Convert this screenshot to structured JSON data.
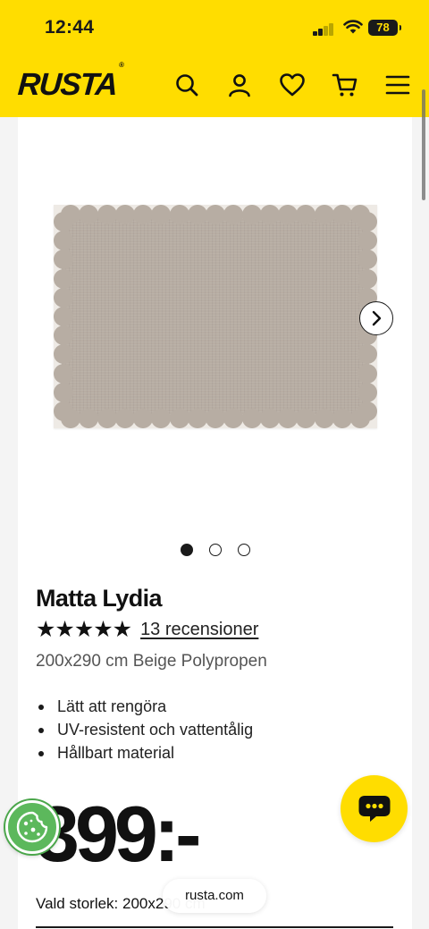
{
  "status_bar": {
    "time": "12:44",
    "battery": "78"
  },
  "header": {
    "logo": "RUSTA",
    "logo_mark": "®",
    "icons": [
      "search-icon",
      "account-icon",
      "heart-icon",
      "cart-icon",
      "menu-icon"
    ],
    "background": "#ffdd00"
  },
  "gallery": {
    "image": "rug-image",
    "slide_count": 3,
    "active_slide": 1
  },
  "product": {
    "title": "Matta Lydia",
    "stars": "★★★★★",
    "rating": 5,
    "reviews": "13 recensioner",
    "variant": "200x290 cm Beige Polypropen",
    "bullets": [
      "Lätt att rengöra",
      "UV-resistent och vattentålig",
      "Hållbart material"
    ],
    "price": "399:-",
    "size_label": "Vald storlek: 200x290 cm"
  },
  "browser": {
    "url": "rusta.com"
  },
  "colors": {
    "accent": "#ffdd00",
    "cookie": "#5cb85c",
    "text": "#1a1a1a"
  }
}
